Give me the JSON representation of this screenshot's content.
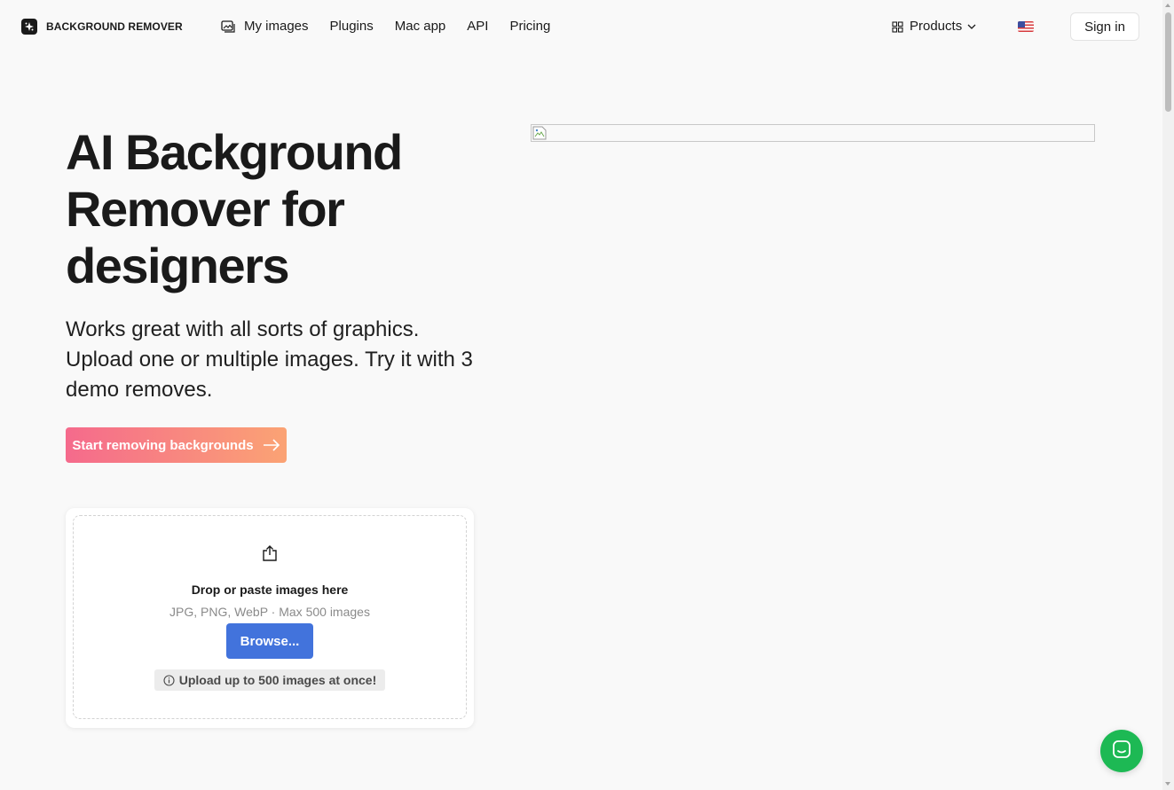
{
  "header": {
    "brand": "BACKGROUND REMOVER",
    "nav": [
      {
        "label": "My images",
        "icon": "image-icon"
      },
      {
        "label": "Plugins"
      },
      {
        "label": "Mac app"
      },
      {
        "label": "API"
      },
      {
        "label": "Pricing"
      }
    ],
    "products_label": "Products",
    "language_flag": "us-flag-icon",
    "signin_label": "Sign in"
  },
  "hero": {
    "title": "AI Background Remover for designers",
    "subtitle": "Works great with all sorts of graphics. Upload one or multiple images. Try it with 3 demo removes.",
    "cta_label": "Start removing backgrounds"
  },
  "upload": {
    "title": "Drop or paste images here",
    "formats": "JPG, PNG, WebP · Max 500 images",
    "browse_label": "Browse...",
    "tip": "Upload up to 500 images at once!"
  },
  "colors": {
    "cta_gradient_start": "#f56a8c",
    "cta_gradient_end": "#fba374",
    "browse_button": "#4273dc",
    "chat_button": "#1db954"
  }
}
